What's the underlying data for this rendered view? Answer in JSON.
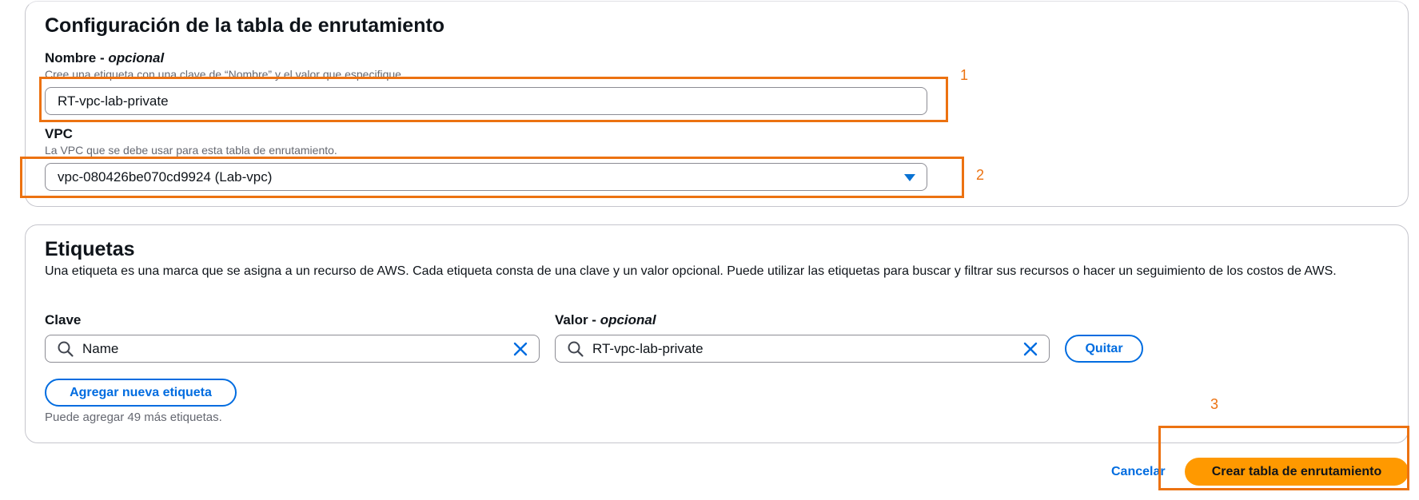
{
  "route_table_config": {
    "title": "Configuración de la tabla de enrutamiento",
    "name_field": {
      "label": "Nombre - ",
      "optional": "opcional",
      "description": "Cree una etiqueta con una clave de “Nombre” y el valor que especifique.",
      "value": "RT-vpc-lab-private"
    },
    "vpc_field": {
      "label": "VPC",
      "description": "La VPC que se debe usar para esta tabla de enrutamiento.",
      "value": "vpc-080426be070cd9924 (Lab-vpc)"
    }
  },
  "tags": {
    "title": "Etiquetas",
    "description": "Una etiqueta es una marca que se asigna a un recurso de AWS. Cada etiqueta consta de una clave y un valor opcional. Puede utilizar las etiquetas para buscar y filtrar sus recursos o hacer un seguimiento de los costos de AWS.",
    "key_label": "Clave",
    "value_label": "Valor - ",
    "value_optional": "opcional",
    "rows": [
      {
        "key": "Name",
        "value": "RT-vpc-lab-private",
        "remove_label": "Quitar"
      }
    ],
    "add_button": "Agregar nueva etiqueta",
    "limit_hint": "Puede agregar 49 más etiquetas."
  },
  "footer": {
    "cancel_label": "Cancelar",
    "create_label": "Crear tabla de enrutamiento"
  },
  "annotations": [
    "1",
    "2",
    "3"
  ],
  "colors": {
    "accent_blue": "#006ce0",
    "primary_orange": "#ff9900",
    "annotation_orange": "#ec7211"
  },
  "icons": [
    "search-icon",
    "clear-icon",
    "caret-down-icon"
  ]
}
